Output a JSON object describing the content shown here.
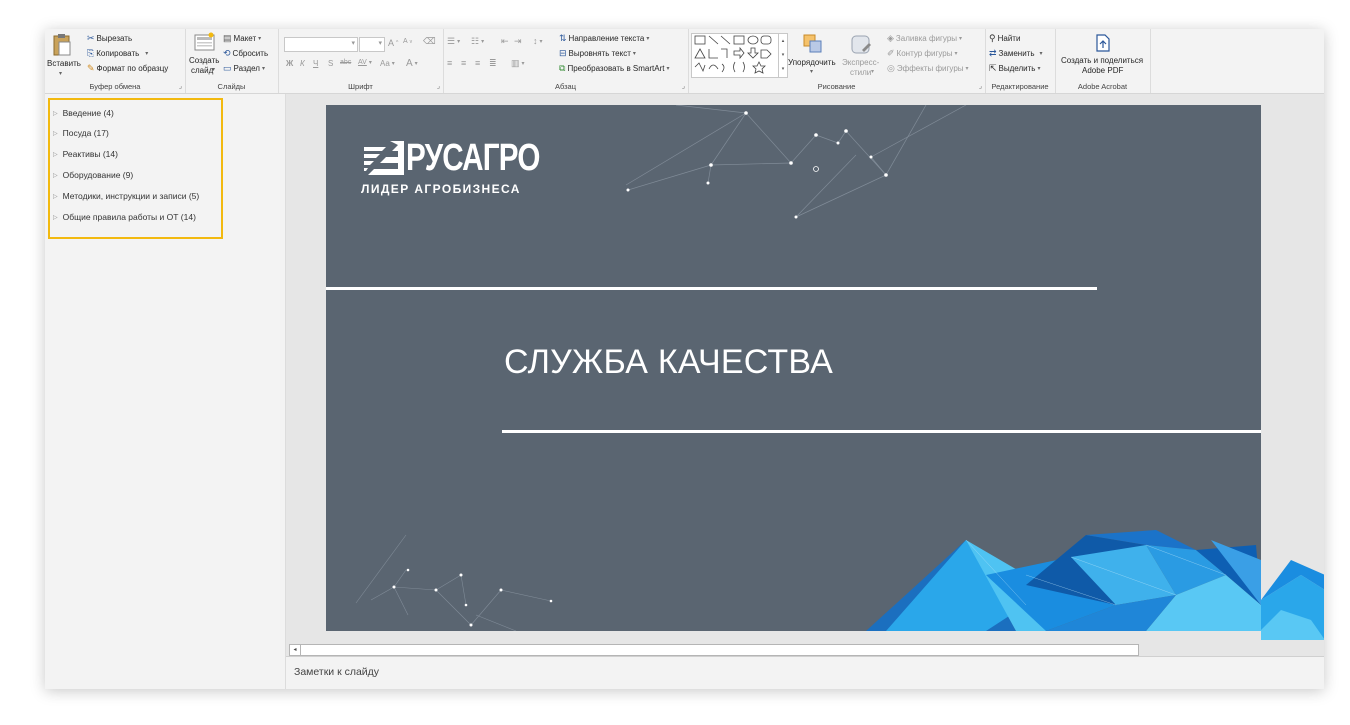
{
  "ribbon": {
    "clipboard": {
      "paste": "Вставить",
      "cut": "Вырезать",
      "copy": "Копировать",
      "format_painter": "Формат по образцу",
      "label": "Буфер обмена"
    },
    "slides": {
      "new_slide_line1": "Создать",
      "new_slide_line2": "слайд",
      "layout": "Макет",
      "reset": "Сбросить",
      "section": "Раздел",
      "label": "Слайды"
    },
    "font": {
      "bold": "Ж",
      "italic": "К",
      "underline": "Ч",
      "shadow": "S",
      "strike": "abc",
      "spacing": "AV",
      "case": "Aa",
      "color": "A",
      "grow": "A",
      "shrink": "A",
      "label": "Шрифт"
    },
    "paragraph": {
      "text_direction": "Направление текста",
      "align_text": "Выровнять текст",
      "smartart": "Преобразовать в SmartArt",
      "label": "Абзац"
    },
    "drawing": {
      "arrange": "Упорядочить",
      "quick_styles_line1": "Экспресс-",
      "quick_styles_line2": "стили",
      "shape_fill": "Заливка фигуры",
      "shape_outline": "Контур фигуры",
      "shape_effects": "Эффекты фигуры",
      "label": "Рисование"
    },
    "editing": {
      "find": "Найти",
      "replace": "Заменить",
      "select": "Выделить",
      "label": "Редактирование"
    },
    "acrobat": {
      "create_line1": "Создать и поделиться",
      "create_line2": "Adobe PDF",
      "label": "Adobe Acrobat"
    }
  },
  "outline": {
    "sections": [
      "Введение (4)",
      "Посуда (17)",
      "Реактивы (14)",
      "Оборудование (9)",
      "Методики, инструкции и записи (5)",
      "Общие правила работы и ОТ (14)"
    ]
  },
  "slide": {
    "logo_name": "РУСАГРО",
    "logo_tagline": "ЛИДЕР АГРОБИЗНЕСА",
    "title": "СЛУЖБА КАЧЕСТВА"
  },
  "notes": {
    "placeholder": "Заметки к слайду"
  },
  "colors": {
    "slide_bg": "#5a6571",
    "highlight": "#f2b90f",
    "accent_blue": "#2b579a",
    "crystal_blue": "#1e9be0"
  }
}
